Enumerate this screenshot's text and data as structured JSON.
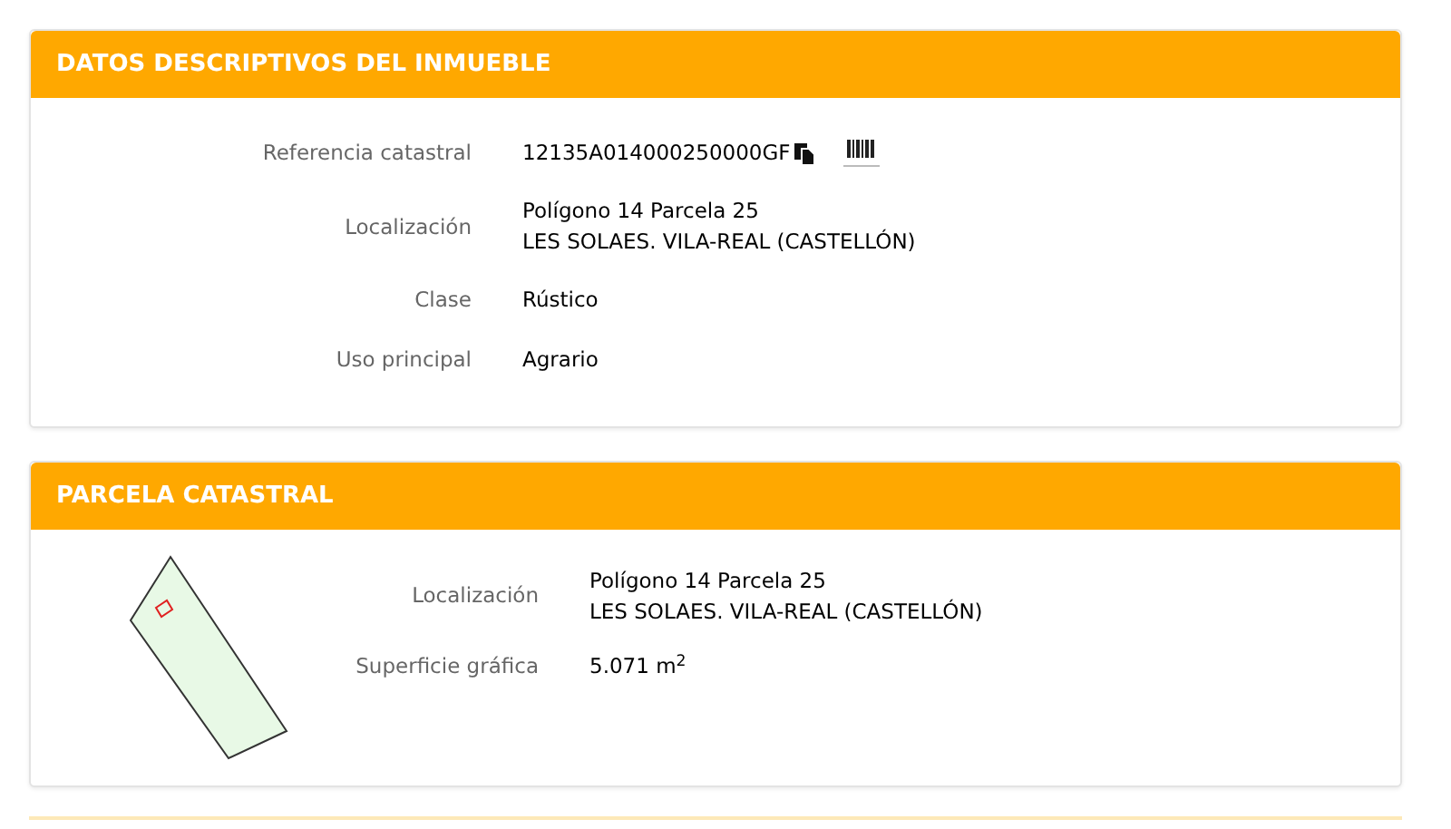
{
  "sections": [
    {
      "title": "DATOS DESCRIPTIVOS DEL INMUEBLE",
      "kind": "details",
      "rows": [
        {
          "label": "Referencia catastral",
          "kind": "reference",
          "lines": [
            "12135A014000250000GF"
          ]
        },
        {
          "label": "Localización",
          "kind": "text",
          "lines": [
            "Polígono 14 Parcela 25",
            "LES SOLAES. VILA-REAL (CASTELLÓN)"
          ]
        },
        {
          "label": "Clase",
          "kind": "text",
          "lines": [
            "Rústico"
          ]
        },
        {
          "label": "Uso principal",
          "kind": "text",
          "lines": [
            "Agrario"
          ]
        }
      ]
    },
    {
      "title": "PARCELA CATASTRAL",
      "kind": "parcel",
      "rows": [
        {
          "label": "Localización",
          "kind": "text",
          "lines": [
            "Polígono 14 Parcela 25",
            "LES SOLAES. VILA-REAL (CASTELLÓN)"
          ]
        },
        {
          "label": "Superficie gráfica",
          "kind": "text",
          "lines": [
            "5.071 m$^{2}$"
          ]
        }
      ]
    }
  ]
}
